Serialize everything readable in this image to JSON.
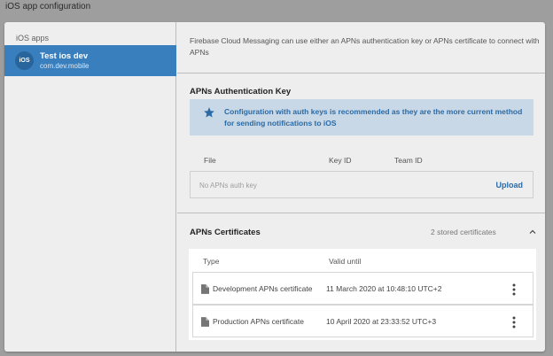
{
  "page": {
    "title": "iOS app configuration"
  },
  "sidebar": {
    "header": "iOS apps",
    "apps": [
      {
        "badge": "iOS",
        "name": "Test ios dev",
        "bundle": "com.dev.mobile"
      }
    ]
  },
  "intro": "Firebase Cloud Messaging can use either an APNs authentication key or APNs certificate to connect with APNs",
  "auth_key": {
    "title": "APNs Authentication Key",
    "info": "Configuration with auth keys is recommended as they are the more current method for sending notifications to iOS",
    "columns": {
      "file": "File",
      "key_id": "Key ID",
      "team_id": "Team ID"
    },
    "empty_text": "No APNs auth key",
    "upload_label": "Upload"
  },
  "certificates": {
    "title": "APNs Certificates",
    "stored_count": "2 stored certificates",
    "columns": {
      "type": "Type",
      "valid_until": "Valid until"
    },
    "rows": [
      {
        "type": "Development APNs certificate",
        "valid_until": "11 March 2020 at 10:48:10 UTC+2"
      },
      {
        "type": "Production APNs certificate",
        "valid_until": "10 April 2020 at 23:33:52 UTC+3"
      }
    ]
  },
  "icons": {
    "info": "star-icon",
    "collapse": "chevron-up-icon",
    "row_menu": "more-vert-icon",
    "document": "document-icon"
  },
  "colors": {
    "accent": "#3a7fbd",
    "info_bg": "#c9d8e6",
    "link": "#2a6aa6"
  }
}
